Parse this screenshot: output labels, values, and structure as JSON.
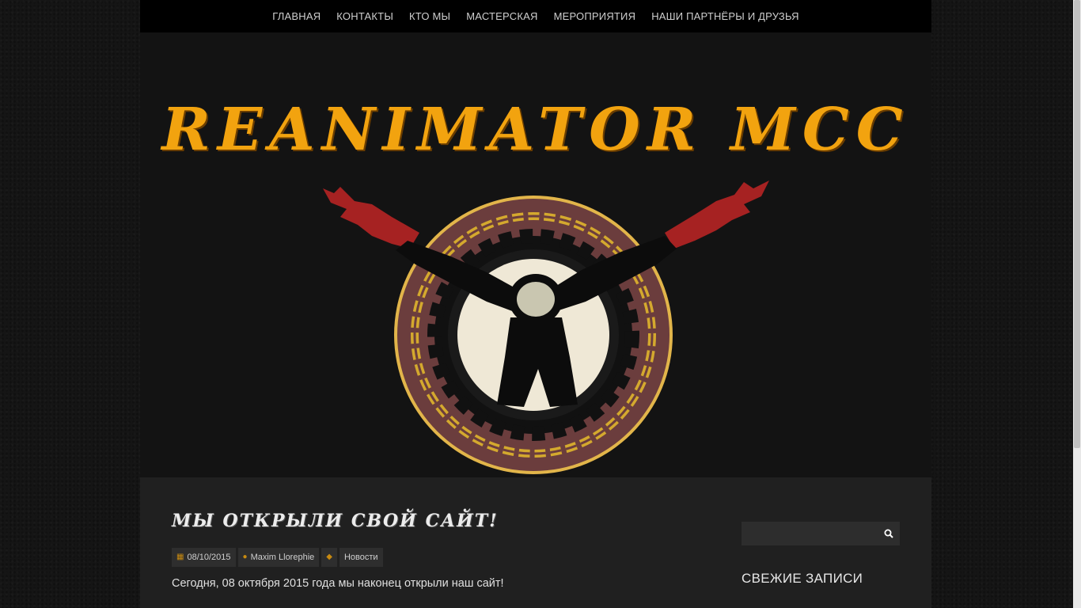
{
  "nav": {
    "items": [
      "ГЛАВНАЯ",
      "КОНТАКТЫ",
      "КТО МЫ",
      "МАСТЕРСКАЯ",
      "МЕРОПРИЯТИЯ",
      "НАШИ ПАРТНЁРЫ И ДРУЗЬЯ"
    ]
  },
  "header": {
    "site_title": "REANIMATOR MCC",
    "title_color": "#f2a30f"
  },
  "post": {
    "title": "МЫ ОТКРЫЛИ СВОЙ САЙТ!",
    "date": "08/10/2015",
    "author": "Maxim Llorephie",
    "category": "Новости",
    "excerpt": "Сегодня, 08 октября 2015 года мы наконец открыли наш сайт!"
  },
  "sidebar": {
    "search_placeholder": "",
    "recent_posts_title": "СВЕЖИЕ ЗАПИСИ"
  },
  "icons": {
    "date": "calendar-icon",
    "author": "user-icon",
    "category": "tag-icon",
    "search": "search-icon"
  }
}
